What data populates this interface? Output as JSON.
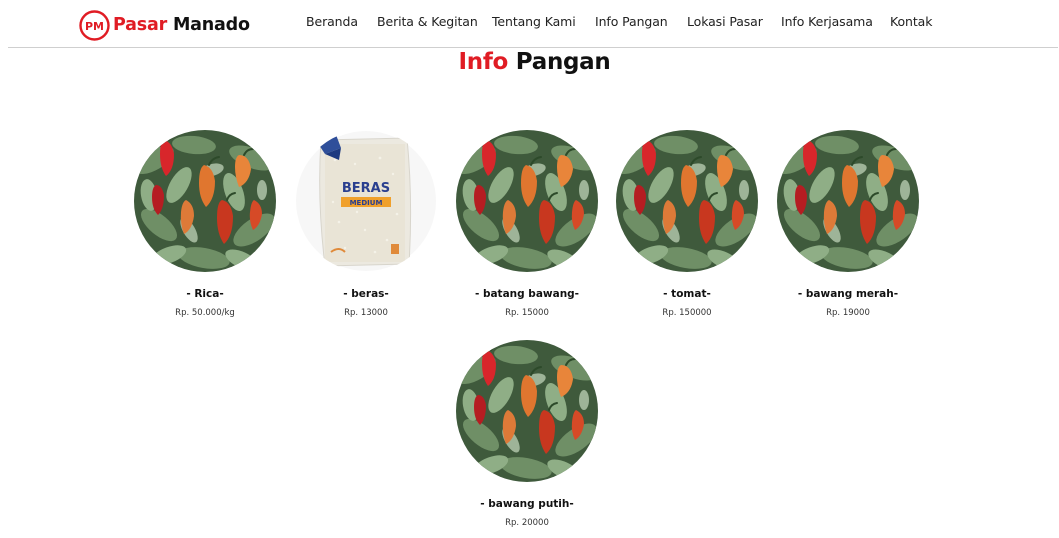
{
  "brand": {
    "name_accent": "Pasar",
    "name_rest": "Manado",
    "logo_text": "PM"
  },
  "nav": {
    "items": [
      {
        "label": "Beranda"
      },
      {
        "label": "Berita & Kegitan"
      },
      {
        "label": "Tentang Kami"
      },
      {
        "label": "Info Pangan"
      },
      {
        "label": "Lokasi Pasar"
      },
      {
        "label": "Info Kerjasama"
      },
      {
        "label": "Kontak"
      }
    ]
  },
  "page": {
    "title_accent": "Info",
    "title_rest": "Pangan"
  },
  "products": [
    {
      "title": "- Rica-",
      "price": "Rp. 50.000/kg",
      "image": "chili-peppers"
    },
    {
      "title": "- beras-",
      "price": "Rp. 13000",
      "image": "rice-bag"
    },
    {
      "title": "- batang bawang-",
      "price": "Rp. 15000",
      "image": "chili-peppers"
    },
    {
      "title": "- tomat-",
      "price": "Rp. 150000",
      "image": "chili-peppers"
    },
    {
      "title": "- bawang merah-",
      "price": "Rp. 19000",
      "image": "chili-peppers"
    },
    {
      "title": "- bawang putih-",
      "price": "Rp. 20000",
      "image": "chili-peppers"
    }
  ],
  "rice_bag": {
    "brand": "BERAS",
    "grade": "MEDIUM"
  },
  "colors": {
    "accent": "#e01c24",
    "text": "#111111",
    "divider": "#cfcfcf"
  }
}
